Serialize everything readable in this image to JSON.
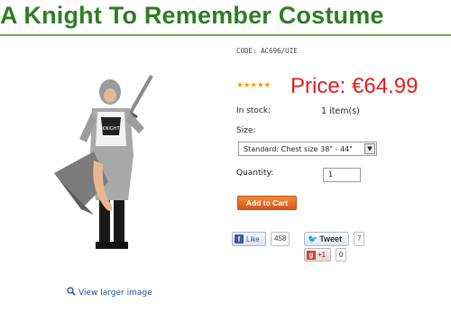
{
  "product": {
    "title": "A Knight To Remember Costume",
    "code": "CODE: AC696/UIE",
    "rating_stars": "★★★★★",
    "rating_value": 5,
    "price": "Price: €64.99"
  },
  "stock": {
    "label": "In stock:",
    "value": "1 item(s)"
  },
  "size": {
    "label": "Size:",
    "selected": "Standard: Chest size 38\" - 44\""
  },
  "quantity": {
    "label": "Quantity:",
    "value": "1"
  },
  "buttons": {
    "add_to_cart": "Add to Cart",
    "view_larger": "View larger image"
  },
  "social": {
    "facebook_label": "Like",
    "facebook_count": "458",
    "twitter_label": "Tweet",
    "twitter_count": "7",
    "gplus_label": "+1",
    "gplus_count": "0"
  },
  "colors": {
    "title": "#2e7d23",
    "price": "#e01e1e",
    "cart": "#e06a24",
    "link": "#1a4f9c"
  }
}
